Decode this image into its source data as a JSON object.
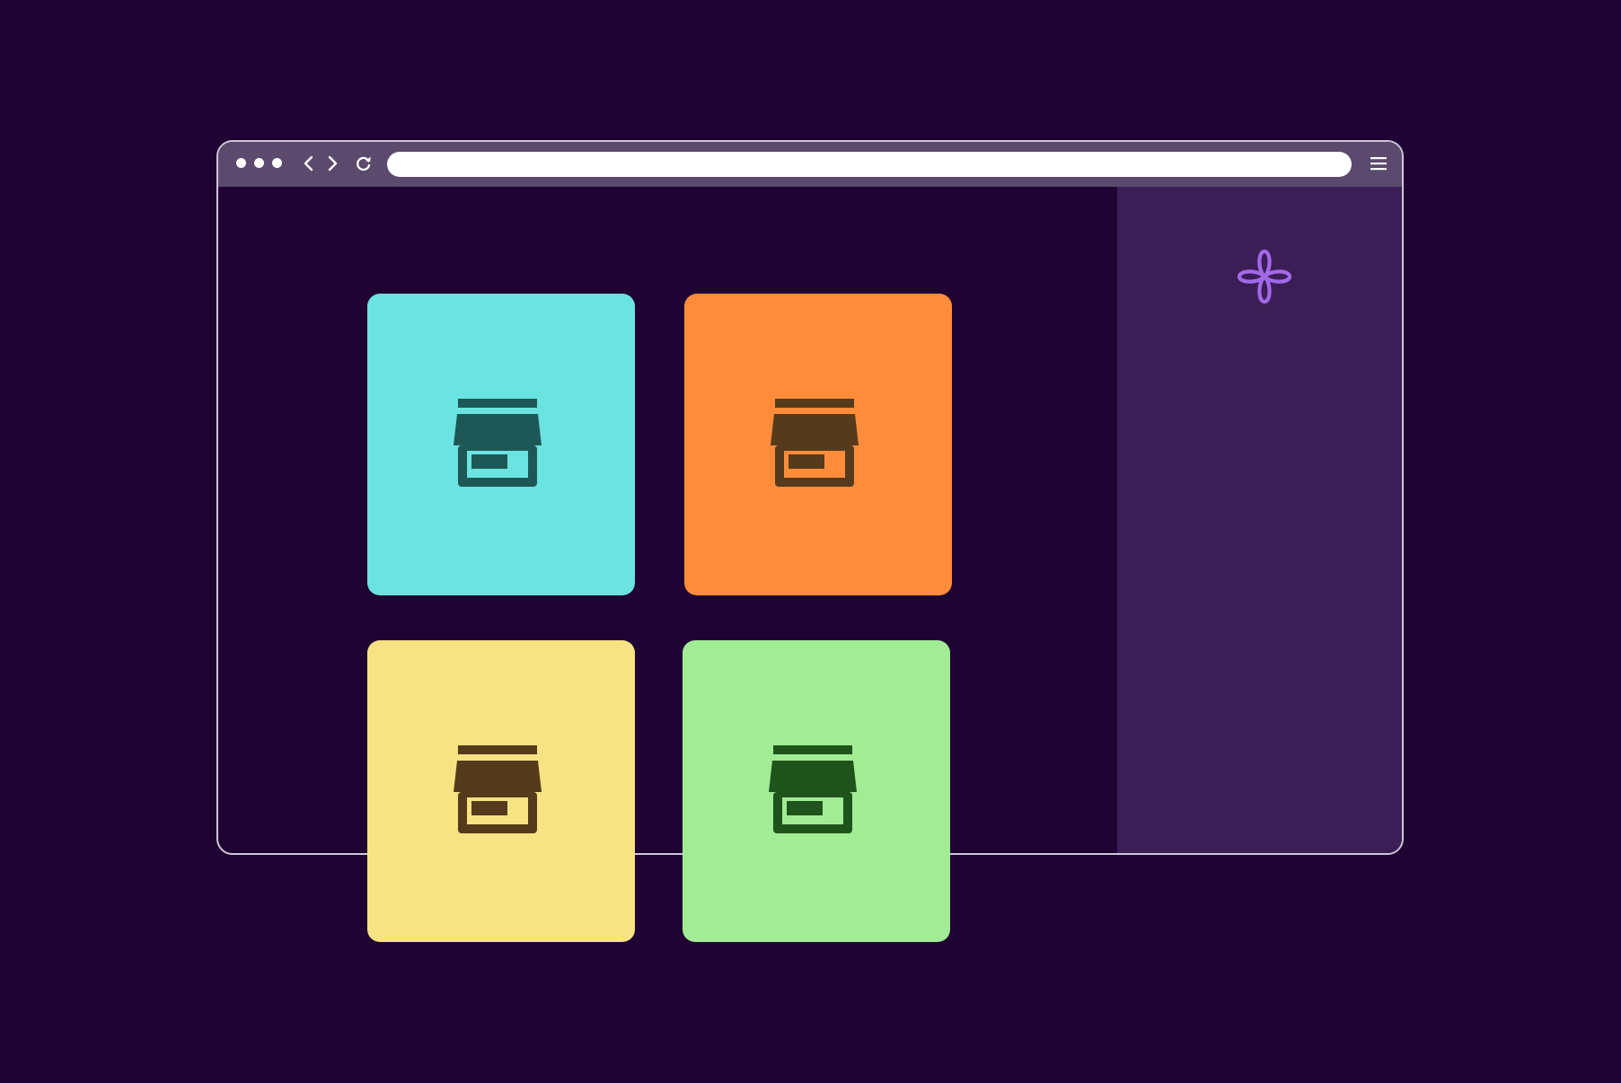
{
  "browser": {
    "address_bar": {
      "value": "",
      "placeholder": ""
    },
    "toolbar_icons": [
      "window-dots-icon",
      "back-icon",
      "forward-icon",
      "reload-icon",
      "menu-icon"
    ]
  },
  "sidebar": {
    "logo_icon": "four-petal-knot-icon",
    "accent_color": "#a06ae8"
  },
  "cards": [
    {
      "color": "#6be3e1",
      "icon": "storefront-icon",
      "icon_color": "#1e5856"
    },
    {
      "color": "#ff8c3a",
      "icon": "storefront-icon",
      "icon_color": "#553a1c"
    },
    {
      "color": "#f8e382",
      "icon": "storefront-icon",
      "icon_color": "#553a1c"
    },
    {
      "color": "#a2ec95",
      "icon": "storefront-icon",
      "icon_color": "#1e541c"
    }
  ]
}
